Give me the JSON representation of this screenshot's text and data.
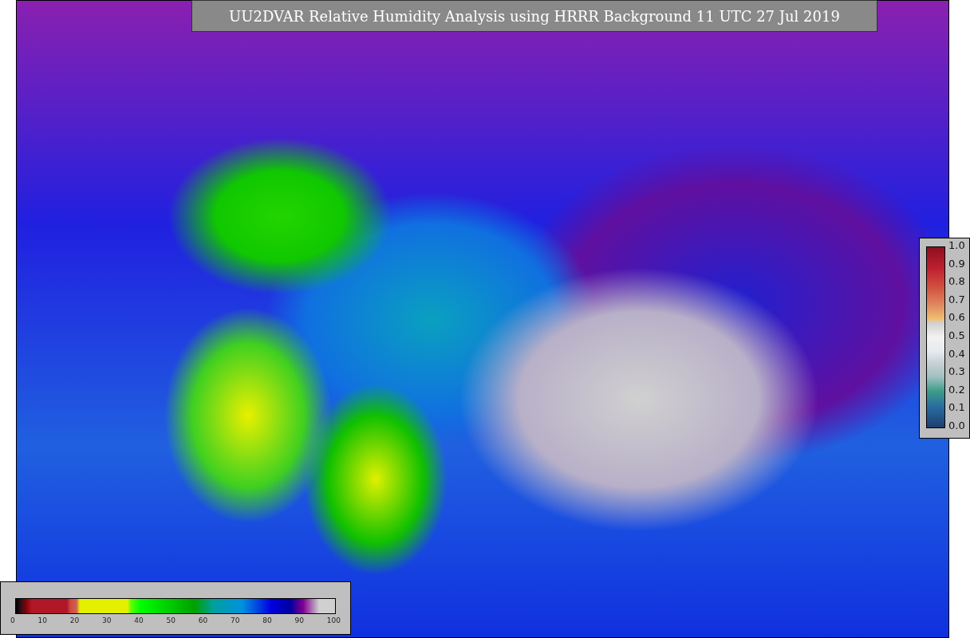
{
  "title": "UU2DVAR Relative Humidity Analysis using HRRR Background 11 UTC 27 Jul 2019",
  "observation_colorbar": {
    "ticks": [
      "1.0",
      "0.9",
      "0.8",
      "0.7",
      "0.6",
      "0.5",
      "0.4",
      "0.3",
      "0.2",
      "0.1",
      "0.0"
    ]
  },
  "humidity_colorbar": {
    "ticks": [
      "0",
      "10",
      "20",
      "30",
      "40",
      "50",
      "60",
      "70",
      "80",
      "90",
      "100"
    ]
  }
}
